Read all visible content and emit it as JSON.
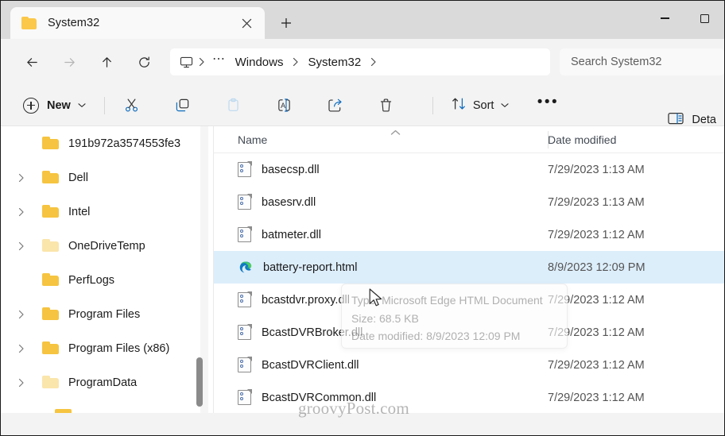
{
  "window": {
    "tab": {
      "title": "System32",
      "folder_icon": "folder-icon",
      "close_icon": "close-icon"
    },
    "new_tab_label": "+",
    "controls": {
      "minimize": "minimize-icon",
      "maximize": "maximize-icon"
    }
  },
  "nav": {
    "back": "back-arrow-icon",
    "forward": "forward-arrow-icon",
    "up": "up-arrow-icon",
    "refresh": "refresh-icon",
    "address": {
      "root_icon": "this-pc-icon",
      "overflow": "⋯",
      "crumbs": [
        "Windows",
        "System32"
      ]
    },
    "search": {
      "placeholder": "Search System32",
      "value": ""
    }
  },
  "toolbar": {
    "new_label": "New",
    "cut_icon": "cut-icon",
    "copy_icon": "copy-icon",
    "paste_icon": "paste-icon",
    "rename_icon": "rename-icon",
    "share_icon": "share-icon",
    "delete_icon": "delete-icon",
    "sort_label": "Sort",
    "more_label": "•••",
    "view_details_label": "Deta"
  },
  "sidebar": {
    "items": [
      {
        "label": "191b972a3574553fe3",
        "expandable": false,
        "dim": false
      },
      {
        "label": "Dell",
        "expandable": true,
        "dim": false
      },
      {
        "label": "Intel",
        "expandable": true,
        "dim": false
      },
      {
        "label": "OneDriveTemp",
        "expandable": true,
        "dim": true
      },
      {
        "label": "PerfLogs",
        "expandable": false,
        "dim": false
      },
      {
        "label": "Program Files",
        "expandable": true,
        "dim": false
      },
      {
        "label": "Program Files (x86)",
        "expandable": true,
        "dim": false
      },
      {
        "label": "ProgramData",
        "expandable": true,
        "dim": true
      }
    ]
  },
  "filelist": {
    "columns": {
      "name": "Name",
      "date_modified": "Date modified"
    },
    "sort_indicator": "ascending-sort-icon",
    "rows": [
      {
        "name": "basecsp.dll",
        "date": "7/29/2023 1:13 AM",
        "icon": "dll-file-icon",
        "selected": false
      },
      {
        "name": "basesrv.dll",
        "date": "7/29/2023 1:13 AM",
        "icon": "dll-file-icon",
        "selected": false
      },
      {
        "name": "batmeter.dll",
        "date": "7/29/2023 1:12 AM",
        "icon": "dll-file-icon",
        "selected": false
      },
      {
        "name": "battery-report.html",
        "date": "8/9/2023 12:09 PM",
        "icon": "edge-html-file-icon",
        "selected": true
      },
      {
        "name": "bcastdvr.proxy.dll",
        "date": "7/29/2023 1:12 AM",
        "icon": "dll-file-icon",
        "selected": false
      },
      {
        "name": "BcastDVRBroker.dll",
        "date": "7/29/2023 1:12 AM",
        "icon": "dll-file-icon",
        "selected": false
      },
      {
        "name": "BcastDVRClient.dll",
        "date": "7/29/2023 1:12 AM",
        "icon": "dll-file-icon",
        "selected": false
      },
      {
        "name": "BcastDVRCommon.dll",
        "date": "7/29/2023 1:12 AM",
        "icon": "dll-file-icon",
        "selected": false
      }
    ]
  },
  "tooltip": {
    "type": "Type: Microsoft Edge HTML Document",
    "size": "Size: 68.5 KB",
    "modified": "Date modified: 8/9/2023 12:09 PM"
  },
  "watermark": "groovyPost.com",
  "colors": {
    "accent": "#0078d4",
    "selection": "#ddeefb",
    "titlebar": "#dadada",
    "chrome": "#f3f3f3",
    "folder": "#f6c440"
  }
}
